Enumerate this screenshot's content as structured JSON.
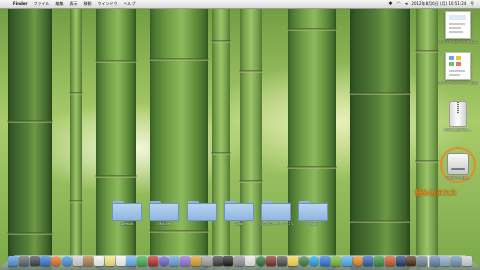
{
  "menubar": {
    "apple": "",
    "items": [
      "Finder",
      "ファイル",
      "編集",
      "表示",
      "移動",
      "ウインドウ",
      "ヘルプ"
    ],
    "status": {
      "datetime": "2012年8月6日 (月) 10:51:24"
    },
    "status_icons": [
      "bluetooth-icon",
      "wifi-icon",
      "volume-icon",
      "battery-icon",
      "spotlight-icon"
    ]
  },
  "desktop_icons": [
    {
      "name": "screenshot-1",
      "label": "スクリーンショット 2012-...",
      "type": "image"
    },
    {
      "name": "screenshot-2",
      "label": "スクリーンショット 2012-...",
      "type": "image"
    },
    {
      "name": "archive",
      "label": "ArchiveUtility-...",
      "type": "archive"
    },
    {
      "name": "disk",
      "label": "WINOPEUDE...",
      "type": "disk"
    }
  ],
  "annotation": "読み込まれた",
  "folders": [
    {
      "label": "Default"
    },
    {
      "label": "Mobile"
    },
    {
      "label": ""
    },
    {
      "label": "Data"
    },
    {
      "label": "ダウンロード・プログラム"
    },
    {
      "label": "Work"
    }
  ],
  "dock": {
    "items": [
      {
        "icon": "finder-icon",
        "color": "#4f8fd6"
      },
      {
        "icon": "launchpad-icon",
        "color": "#5a5f68"
      },
      {
        "icon": "mission-control-icon",
        "color": "#3b3f46"
      },
      {
        "icon": "app-store-icon",
        "color": "#2d74c9"
      },
      {
        "icon": "firefox-icon",
        "color": "#e36b1c"
      },
      {
        "icon": "safari-icon",
        "color": "#3a8ddb"
      },
      {
        "icon": "mail-icon",
        "color": "#c9ccd2"
      },
      {
        "icon": "contacts-icon",
        "color": "#a97845"
      },
      {
        "icon": "calendar-icon",
        "color": "#f0f0f0"
      },
      {
        "icon": "notes-icon",
        "color": "#f4e07a"
      },
      {
        "icon": "reminders-icon",
        "color": "#f2f2f2"
      },
      {
        "icon": "messages-icon",
        "color": "#5fa8e6"
      },
      {
        "icon": "facetime-icon",
        "color": "#39a84a"
      },
      {
        "icon": "photo-booth-icon",
        "color": "#b02a2a"
      },
      {
        "icon": "itunes-icon",
        "color": "#6a5acd"
      },
      {
        "icon": "iphoto-icon",
        "color": "#5e9ad6"
      },
      {
        "icon": "imovie-icon",
        "color": "#8a6bd1"
      },
      {
        "icon": "garageband-icon",
        "color": "#d89b2a"
      },
      {
        "icon": "preview-icon",
        "color": "#9b9b9b"
      },
      {
        "icon": "chess-icon",
        "color": "#383838"
      },
      {
        "icon": "terminal-icon",
        "color": "#1a1a1a"
      },
      {
        "icon": "system-preferences-icon",
        "color": "#8a8f96"
      },
      {
        "icon": "text-edit-icon",
        "color": "#e5e5e5"
      },
      {
        "icon": "activity-monitor-icon",
        "color": "#2f6a32"
      },
      {
        "icon": "dictionary-icon",
        "color": "#7b2c2c"
      },
      {
        "icon": "calculator-icon",
        "color": "#4a4a4a"
      },
      {
        "icon": "stickies-icon",
        "color": "#f2d24a"
      },
      {
        "icon": "time-machine-icon",
        "color": "#3a7a3a"
      },
      {
        "icon": "skype-icon",
        "color": "#1aa0e6"
      },
      {
        "icon": "dropbox-icon",
        "color": "#2a6fd6"
      },
      {
        "icon": "evernote-icon",
        "color": "#6fb43a"
      },
      {
        "icon": "twitter-icon",
        "color": "#4aa8e8"
      },
      {
        "icon": "vlc-icon",
        "color": "#e8801a"
      },
      {
        "icon": "word-icon",
        "color": "#2b5aa8"
      },
      {
        "icon": "excel-icon",
        "color": "#2e8a3e"
      },
      {
        "icon": "powerpoint-icon",
        "color": "#c8502a"
      },
      {
        "icon": "photoshop-icon",
        "color": "#1e3a6a"
      },
      {
        "icon": "illustrator-icon",
        "color": "#4a2a10"
      },
      {
        "icon": "utilities-icon",
        "color": "#6d7f95"
      }
    ],
    "stacks": [
      {
        "icon": "applications-stack-icon",
        "color": "#5d7fa8"
      },
      {
        "icon": "documents-stack-icon",
        "color": "#8aa6c8"
      },
      {
        "icon": "downloads-stack-icon",
        "color": "#6b8db3"
      },
      {
        "icon": "trash-icon",
        "color": "#c7cdd4"
      }
    ]
  }
}
